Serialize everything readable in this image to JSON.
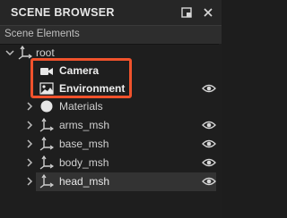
{
  "panel": {
    "title": "SCENE BROWSER",
    "section_label": "Scene Elements"
  },
  "tree": {
    "root_label": "root",
    "camera_label": "Camera",
    "environment_label": "Environment",
    "materials_label": "Materials",
    "items": [
      {
        "label": "arms_msh"
      },
      {
        "label": "base_msh"
      },
      {
        "label": "body_msh"
      },
      {
        "label": "head_msh"
      }
    ]
  },
  "colors": {
    "highlight": "#f0522c",
    "background": "#1e1e1e",
    "text": "#d0d0d0"
  }
}
